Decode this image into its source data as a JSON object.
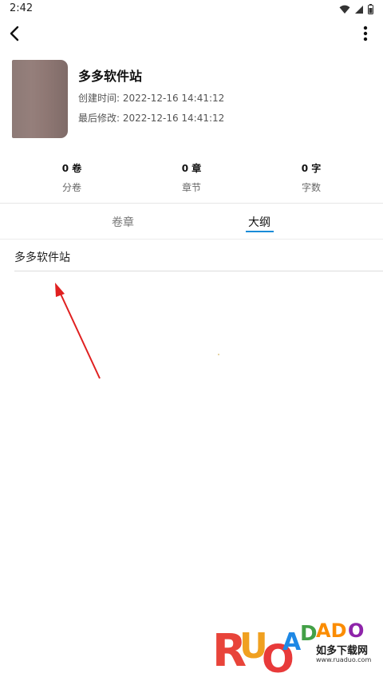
{
  "status_bar": {
    "time": "2:42",
    "icons": [
      "wifi-icon",
      "signal-icon",
      "battery-icon"
    ]
  },
  "app_bar": {
    "back_icon": "back-arrow-icon",
    "menu_icon": "more-vert-icon"
  },
  "book": {
    "title": "多多软件站",
    "created": "创建时间: 2022-12-16 14:41:12",
    "modified": "最后修改: 2022-12-16 14:41:12",
    "cover_color": "#8d7a76"
  },
  "stats": [
    {
      "value": "0 卷",
      "label": "分卷"
    },
    {
      "value": "0 章",
      "label": "章节"
    },
    {
      "value": "0 字",
      "label": "字数"
    }
  ],
  "tabs": [
    {
      "label": "卷章",
      "active": false
    },
    {
      "label": "大纲",
      "active": true
    }
  ],
  "outline": {
    "items": [
      "多多软件站"
    ]
  },
  "colors": {
    "accent": "#1a8cd8",
    "annotation_arrow": "#e02020"
  },
  "watermark": {
    "brand": "RUADADO",
    "cn_text": "如多下载网",
    "url": "www.ruaduo.com"
  }
}
